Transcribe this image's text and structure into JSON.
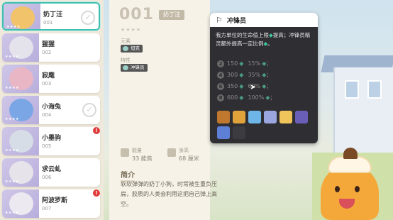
{
  "list": {
    "items": [
      {
        "name": "奶丁汪",
        "num": "001",
        "stars": "★★★★",
        "selected": true,
        "owned": true,
        "alert": false
      },
      {
        "name": "猩猩",
        "num": "002",
        "stars": "★★★★",
        "selected": false,
        "owned": false,
        "alert": false
      },
      {
        "name": "寂麾",
        "num": "003",
        "stars": "★★★★",
        "selected": false,
        "owned": false,
        "alert": false
      },
      {
        "name": "小海兔",
        "num": "004",
        "stars": "★★★★",
        "selected": false,
        "owned": true,
        "alert": false
      },
      {
        "name": "小墨驹",
        "num": "005",
        "stars": "★★★★",
        "selected": false,
        "owned": false,
        "alert": true
      },
      {
        "name": "求云虬",
        "num": "006",
        "stars": "★★★★",
        "selected": false,
        "owned": false,
        "alert": false
      },
      {
        "name": "阿波罗斯",
        "num": "007",
        "stars": "★★★★",
        "selected": false,
        "owned": false,
        "alert": true
      }
    ],
    "alert_mark": "!"
  },
  "detail": {
    "number": "001",
    "name": "奶丁汪",
    "rating": "★★★★",
    "element_label": "元素",
    "element_value": "坦克",
    "trait_label": "特性",
    "trait_value": "冲锋员",
    "stats": [
      {
        "label": "能量",
        "value": "33 能焦"
      },
      {
        "label": "身高",
        "value": "68 厘米"
      }
    ],
    "intro_title": "简介",
    "intro_text": "软软弹弹的奶丁小狗，时常被生重负压扁，胶质的人类会利用这把自己弹上高空。"
  },
  "tooltip": {
    "title": "冲锋员",
    "desc_before": "我方单位的生命值上限",
    "desc_mid1": "提高；冲锋员精灵额外提高一定比例",
    "desc_end": "。",
    "gem_glyph": "◆",
    "tiers": [
      {
        "count": "2",
        "left": "150",
        "right": "15%"
      },
      {
        "count": "4",
        "left": "300",
        "right": "35%"
      },
      {
        "count": "6",
        "left": "350",
        "right": "60%"
      },
      {
        "count": "8",
        "left": "600",
        "right": "100%"
      }
    ],
    "tier_sep": "；",
    "icon_colors": [
      "#c0782f",
      "#e0a23a",
      "#6fb6e8",
      "#9aa6e0",
      "#f0c45a",
      "#6a5fb8",
      "#5d7fd6",
      "#3b3b40"
    ]
  },
  "colors": {
    "accent": "#3fbfb0",
    "gem": "#3cc7a0",
    "tooltip_bg": "#2f2f33"
  }
}
